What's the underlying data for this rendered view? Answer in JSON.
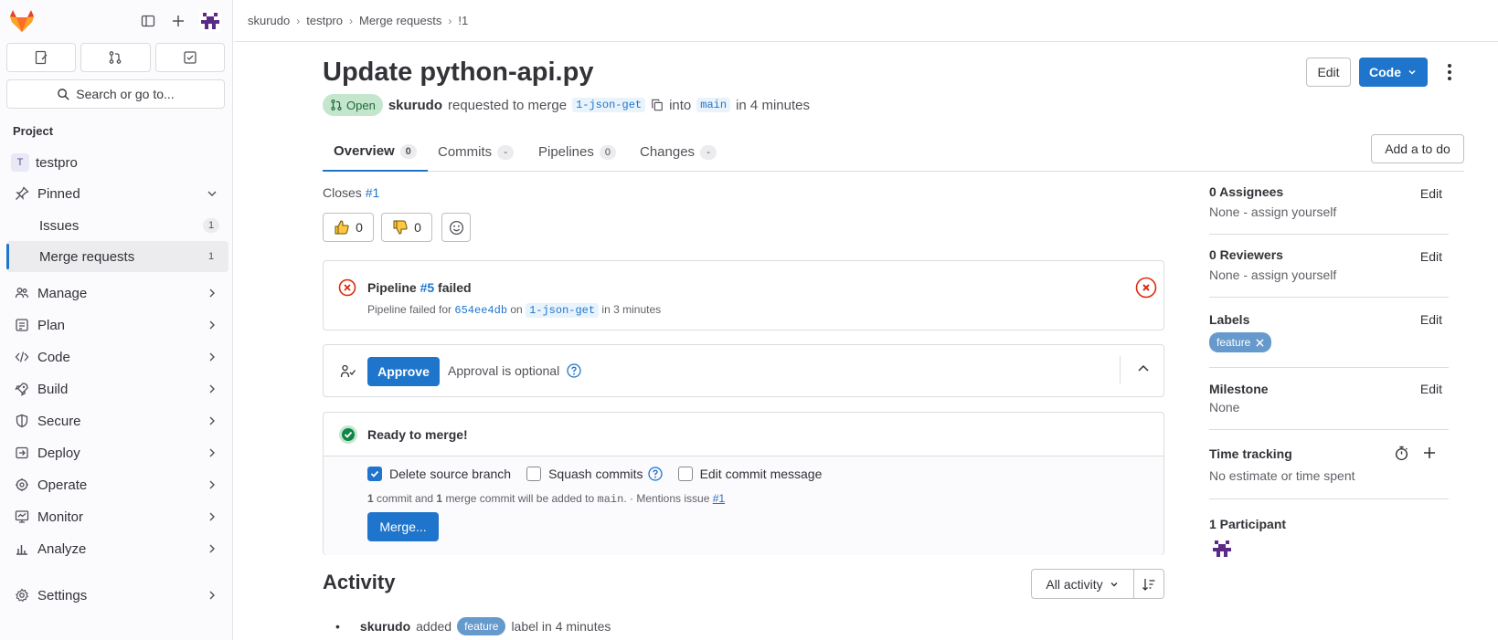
{
  "sidebar": {
    "section_label": "Project",
    "project": {
      "badge": "T",
      "name": "testpro"
    },
    "search_label": "Search or go to...",
    "pinned_label": "Pinned",
    "pinned_items": [
      {
        "label": "Issues",
        "count": "1"
      },
      {
        "label": "Merge requests",
        "count": "1"
      }
    ],
    "nav": [
      {
        "label": "Manage",
        "icon": "users-icon"
      },
      {
        "label": "Plan",
        "icon": "plan-icon"
      },
      {
        "label": "Code",
        "icon": "code-icon"
      },
      {
        "label": "Build",
        "icon": "rocket-icon"
      },
      {
        "label": "Secure",
        "icon": "shield-icon"
      },
      {
        "label": "Deploy",
        "icon": "deploy-icon"
      },
      {
        "label": "Operate",
        "icon": "operate-icon"
      },
      {
        "label": "Monitor",
        "icon": "monitor-icon"
      },
      {
        "label": "Analyze",
        "icon": "chart-icon"
      },
      {
        "label": "Settings",
        "icon": "gear-icon"
      }
    ]
  },
  "breadcrumb": [
    "skurudo",
    "testpro",
    "Merge requests",
    "!1"
  ],
  "mr": {
    "title": "Update python-api.py",
    "edit_label": "Edit",
    "code_label": "Code",
    "status": "Open",
    "author": "skurudo",
    "requested_text": "requested to merge",
    "source_branch": "1-json-get",
    "into_text": "into",
    "target_branch": "main",
    "time_text": "in 4 minutes"
  },
  "tabs": [
    {
      "label": "Overview",
      "count": "0"
    },
    {
      "label": "Commits",
      "count": "-"
    },
    {
      "label": "Pipelines",
      "count": "0"
    },
    {
      "label": "Changes",
      "count": "-"
    }
  ],
  "todo_label": "Add a to do",
  "closes": {
    "text": "Closes",
    "issue": "#1"
  },
  "reactions": {
    "thumbs_up": "0",
    "thumbs_down": "0"
  },
  "pipeline": {
    "prefix": "Pipeline",
    "id": "#5",
    "status": "failed",
    "sub_prefix": "Pipeline failed for",
    "commit": "654ee4db",
    "on_text": "on",
    "branch": "1-json-get",
    "time": "in 3 minutes"
  },
  "approval": {
    "button": "Approve",
    "text": "Approval is optional"
  },
  "merge": {
    "title": "Ready to merge!",
    "options": [
      {
        "label": "Delete source branch",
        "checked": true
      },
      {
        "label": "Squash commits",
        "checked": false
      },
      {
        "label": "Edit commit message",
        "checked": false
      }
    ],
    "info_count1": "1",
    "info_text1": "commit and",
    "info_count2": "1",
    "info_text2": "merge commit will be added to",
    "info_branch": "main",
    "info_text3": ". · Mentions issue",
    "info_issue": "#1",
    "button": "Merge..."
  },
  "activity": {
    "title": "Activity",
    "filter": "All activity",
    "item": {
      "user": "skurudo",
      "action": "added",
      "label": "feature",
      "suffix": "label in 4 minutes"
    }
  },
  "right": {
    "assignees": {
      "title": "0 Assignees",
      "edit": "Edit",
      "value": "None - assign yourself"
    },
    "reviewers": {
      "title": "0 Reviewers",
      "edit": "Edit",
      "value": "None - assign yourself"
    },
    "labels": {
      "title": "Labels",
      "edit": "Edit",
      "label": "feature"
    },
    "milestone": {
      "title": "Milestone",
      "edit": "Edit",
      "value": "None"
    },
    "time_tracking": {
      "title": "Time tracking",
      "value": "No estimate or time spent"
    },
    "participants": {
      "title": "1 Participant"
    }
  },
  "colors": {
    "accent": "#1f75cb",
    "success": "#108548",
    "danger": "#dd2b0e",
    "label": "#6699cc"
  }
}
